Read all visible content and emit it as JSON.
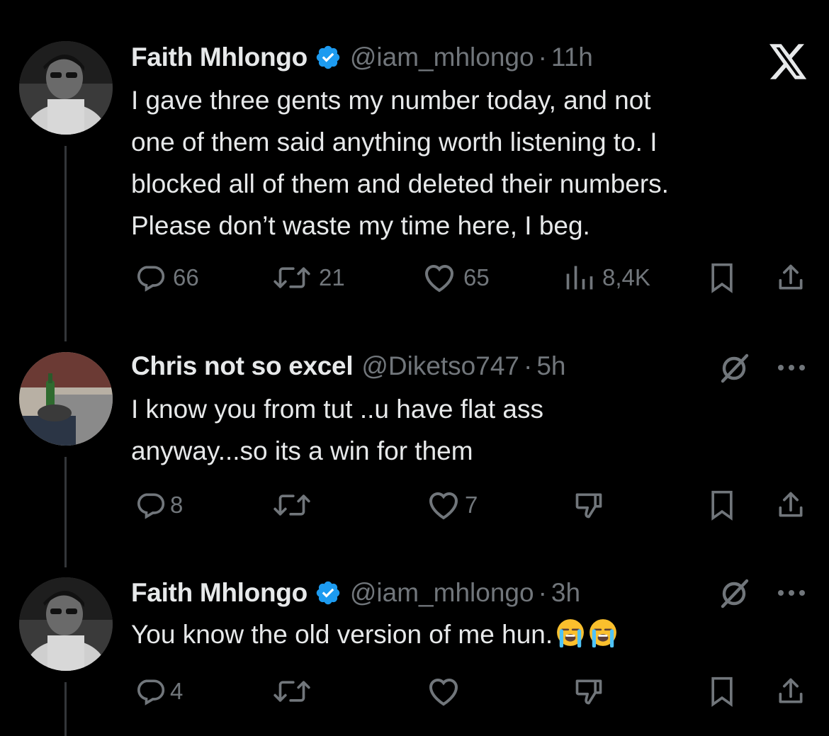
{
  "tweets": [
    {
      "author": "Faith Mhlongo",
      "handle": "@iam_mhlongo",
      "time": "11h",
      "verified": true,
      "text_lines": [
        "I gave three gents my number today, and not",
        "one of them said anything worth listening to. I",
        "blocked all of them and deleted their numbers.",
        "Please don’t waste my time here, I beg."
      ],
      "replies": "66",
      "reposts": "21",
      "likes": "65",
      "views": "8,4K",
      "top_right_icon": "x-logo-icon"
    },
    {
      "author": "Chris not so excel",
      "handle": "@Diketso747",
      "time": "5h",
      "verified": false,
      "text_lines": [
        "I know you from tut ..u have flat ass",
        "anyway...so its a win for them"
      ],
      "replies": "8",
      "reposts": "",
      "likes": "7",
      "top_right_icon": "grok-icon"
    },
    {
      "author": "Faith Mhlongo",
      "handle": "@iam_mhlongo",
      "time": "3h",
      "verified": true,
      "text_lines": [
        "You know the old version of me hun."
      ],
      "emojis": [
        "loudly-crying-face-emoji",
        "loudly-crying-face-emoji"
      ],
      "replies": "4",
      "reposts": "",
      "likes": "",
      "top_right_icon": "grok-icon"
    }
  ],
  "colors": {
    "background": "#000000",
    "text": "#e7e9ea",
    "secondary": "#71767b",
    "verified": "#1d9bf0"
  },
  "separator": "·"
}
